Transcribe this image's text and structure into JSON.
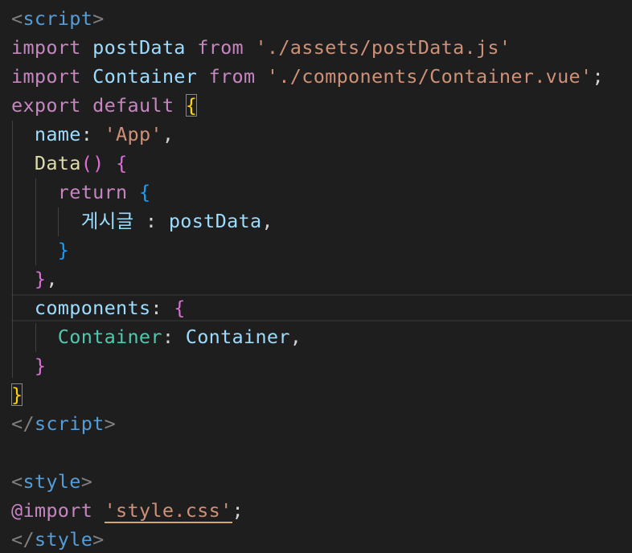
{
  "colors": {
    "background": "#1e1e1e",
    "tag_bracket": "#808080",
    "tag_name": "#569cd6",
    "keyword": "#c586c0",
    "variable": "#9cdcfe",
    "string": "#ce9178",
    "function": "#dcdcaa",
    "component_key": "#4ec9b0",
    "bracket_level1": "#ffd700",
    "bracket_level2": "#da70d6",
    "bracket_level3": "#179fff"
  },
  "code": {
    "l1": {
      "open": "<",
      "tag": "script",
      "close": ">"
    },
    "l2": {
      "kw": "import",
      "name": "postData",
      "from": "from",
      "path": "'./assets/postData.js'"
    },
    "l3": {
      "kw": "import",
      "name": "Container",
      "from": "from",
      "path": "'./components/Container.vue'",
      "end": ";"
    },
    "l4": {
      "kw1": "export",
      "kw2": "default",
      "brace": "{"
    },
    "l5": {
      "key": "name",
      "colon": ":",
      "value": "'App'",
      "comma": ","
    },
    "l6": {
      "fn": "Data",
      "parens": "()",
      "brace": "{"
    },
    "l7": {
      "kw": "return",
      "brace": "{"
    },
    "l8": {
      "key": "게시글",
      "colon": ":",
      "value": "postData",
      "comma": ","
    },
    "l9": {
      "brace": "}"
    },
    "l10": {
      "brace": "}",
      "comma": ","
    },
    "l11": {
      "key": "components",
      "colon": ":",
      "brace": "{"
    },
    "l12": {
      "key": "Container",
      "colon": ":",
      "value": "Container",
      "comma": ","
    },
    "l13": {
      "brace": "}"
    },
    "l14": {
      "brace": "}"
    },
    "l15": {
      "open": "</",
      "tag": "script",
      "close": ">"
    },
    "l17": {
      "open": "<",
      "tag": "style",
      "close": ">"
    },
    "l18": {
      "at": "@import",
      "path": "'style.css'",
      "end": ";"
    },
    "l19": {
      "open": "</",
      "tag": "style",
      "close": ">"
    }
  }
}
